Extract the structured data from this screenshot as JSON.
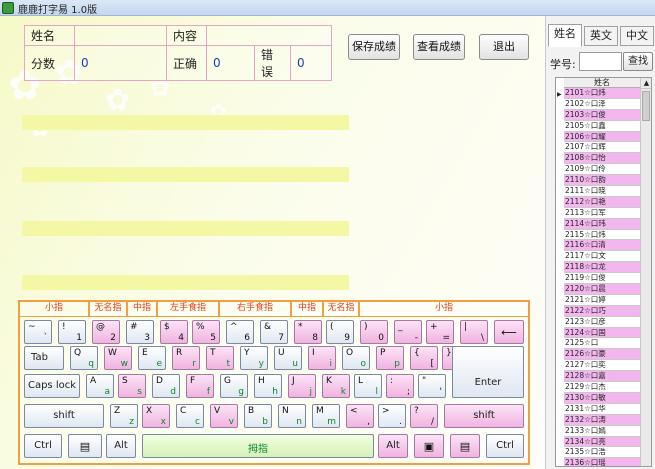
{
  "window": {
    "title": "鹿鹿打字易 1.0版"
  },
  "score": {
    "name_label": "姓名",
    "name_value": "",
    "content_label": "内容",
    "content_value": "",
    "points_label": "分数",
    "points_value": "0",
    "correct_label": "正确",
    "correct_value": "0",
    "error_label": "错误",
    "error_value": "0"
  },
  "buttons": {
    "save": "保存成绩",
    "view": "查看成绩",
    "exit": "退出"
  },
  "zones": [
    "小指",
    "无名指",
    "中指",
    "左手食指",
    "右手食指",
    "中指",
    "无名指",
    "小指"
  ],
  "keys": {
    "tilde_u": "~",
    "tilde_l": "`",
    "k1_u": "!",
    "k1_l": "1",
    "k2_u": "@",
    "k2_l": "2",
    "k3_u": "#",
    "k3_l": "3",
    "k4_u": "$",
    "k4_l": "4",
    "k5_u": "%",
    "k5_l": "5",
    "k6_u": "^",
    "k6_l": "6",
    "k7_u": "&",
    "k7_l": "7",
    "k8_u": "*",
    "k8_l": "8",
    "k9_u": "(",
    "k9_l": "9",
    "k0_u": ")",
    "k0_l": "0",
    "minus_u": "_",
    "minus_l": "-",
    "eq_u": "+",
    "eq_l": "=",
    "bs_u": "|",
    "bs_l": "\\",
    "backspace": "⟵",
    "tab": "Tab",
    "q_u": "Q",
    "q_l": "q",
    "w_u": "W",
    "w_l": "w",
    "e_u": "E",
    "e_l": "e",
    "r_u": "R",
    "r_l": "r",
    "t_u": "T",
    "t_l": "t",
    "y_u": "Y",
    "y_l": "y",
    "u_u": "U",
    "u_l": "u",
    "i_u": "I",
    "i_l": "i",
    "o_u": "O",
    "o_l": "o",
    "p_u": "P",
    "p_l": "p",
    "lb_u": "{",
    "lb_l": "[",
    "rb_u": "}",
    "rb_l": "]",
    "caps": "Caps lock",
    "a_u": "A",
    "a_l": "a",
    "s_u": "S",
    "s_l": "s",
    "d_u": "D",
    "d_l": "d",
    "f_u": "F",
    "f_l": "f",
    "g_u": "G",
    "g_l": "g",
    "h_u": "H",
    "h_l": "h",
    "j_u": "J",
    "j_l": "j",
    "k_u": "K",
    "k_l": "k",
    "l_u": "L",
    "l_l": "l",
    "sc_u": ":",
    "sc_l": ";",
    "qt_u": "\"",
    "qt_l": "'",
    "enter": "Enter",
    "lshift": "shift",
    "z_u": "Z",
    "z_l": "z",
    "x_u": "X",
    "x_l": "x",
    "c_u": "C",
    "c_l": "c",
    "v_u": "V",
    "v_l": "v",
    "b_u": "B",
    "b_l": "b",
    "n_u": "N",
    "n_l": "n",
    "m_u": "M",
    "m_l": "m",
    "cm_u": "<",
    "cm_l": ",",
    "pd_u": ">",
    "pd_l": ".",
    "sl_u": "?",
    "sl_l": "/",
    "rshift": "shift",
    "ctrl": "Ctrl",
    "alt": "Alt",
    "space": "拇指",
    "ralt": "Alt",
    "rctrl": "Ctrl"
  },
  "sidebar": {
    "tabs": [
      "姓名",
      "英文",
      "中文"
    ],
    "student_no_label": "学号:",
    "student_no_value": "",
    "find_button": "查找",
    "grid_header": "姓名",
    "rows": [
      {
        "text": "2101☆口炜",
        "hl": true
      },
      {
        "text": "2102☆口泽",
        "hl": false
      },
      {
        "text": "2103☆口俊",
        "hl": true
      },
      {
        "text": "2105☆口鑫",
        "hl": false
      },
      {
        "text": "2106☆口耀",
        "hl": true
      },
      {
        "text": "2107☆口辉",
        "hl": false
      },
      {
        "text": "2108☆口怡",
        "hl": true
      },
      {
        "text": "2109☆口伶",
        "hl": false
      },
      {
        "text": "2110☆口韵",
        "hl": true
      },
      {
        "text": "2111☆口晓",
        "hl": false
      },
      {
        "text": "2112☆口艳",
        "hl": true
      },
      {
        "text": "2113☆口军",
        "hl": false
      },
      {
        "text": "2114☆口玮",
        "hl": true
      },
      {
        "text": "2115☆口炜",
        "hl": false
      },
      {
        "text": "2116☆口清",
        "hl": true
      },
      {
        "text": "2117☆口文",
        "hl": false
      },
      {
        "text": "2118☆口龙",
        "hl": true
      },
      {
        "text": "2119☆口俊",
        "hl": false
      },
      {
        "text": "2120☆口晨",
        "hl": true
      },
      {
        "text": "2121☆口婷",
        "hl": false
      },
      {
        "text": "2122☆口巧",
        "hl": true
      },
      {
        "text": "2123☆口彦",
        "hl": false
      },
      {
        "text": "2124☆口国",
        "hl": true
      },
      {
        "text": "2125☆口",
        "hl": false
      },
      {
        "text": "2126☆口豪",
        "hl": true
      },
      {
        "text": "2127☆口奕",
        "hl": false
      },
      {
        "text": "2128☆口嘉",
        "hl": true
      },
      {
        "text": "2129☆口杰",
        "hl": false
      },
      {
        "text": "2130☆口敏",
        "hl": true
      },
      {
        "text": "2131☆口华",
        "hl": false
      },
      {
        "text": "2132☆口涛",
        "hl": true
      },
      {
        "text": "2133☆口嫣",
        "hl": false
      },
      {
        "text": "2134☆口亮",
        "hl": true
      },
      {
        "text": "2135☆口浩",
        "hl": false
      },
      {
        "text": "2136☆口瑶",
        "hl": true
      }
    ]
  }
}
